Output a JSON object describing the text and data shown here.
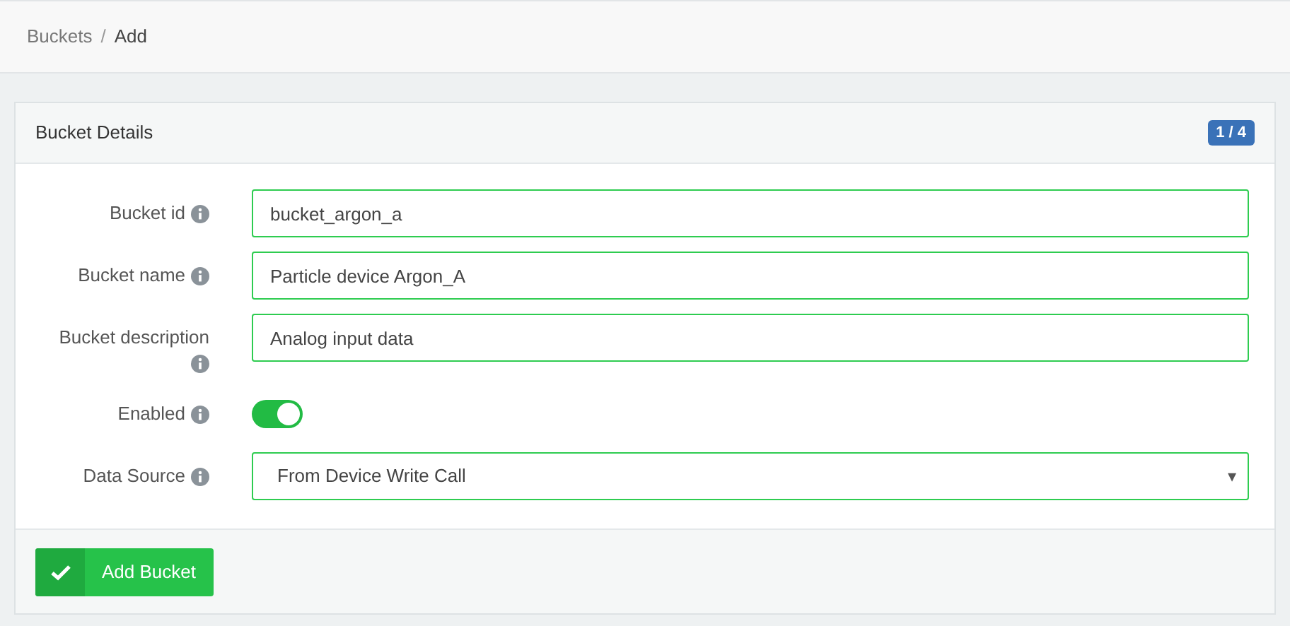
{
  "breadcrumb": [
    {
      "label": "Buckets",
      "current": false
    },
    {
      "label": "Add",
      "current": true
    }
  ],
  "breadcrumb_separator": "/",
  "card": {
    "title": "Bucket Details",
    "step_badge": "1 / 4",
    "fields": [
      {
        "kind": "text",
        "label": "Bucket id",
        "value": "bucket_argon_a"
      },
      {
        "kind": "text",
        "label": "Bucket name",
        "value": "Particle device Argon_A"
      },
      {
        "kind": "text",
        "label": "Bucket description",
        "value": "Analog input data"
      },
      {
        "kind": "toggle",
        "label": "Enabled",
        "on": true
      },
      {
        "kind": "select",
        "label": "Data Source",
        "value": "From Device Write Call",
        "caret": "▾"
      }
    ],
    "submit_button": "Add Bucket"
  }
}
